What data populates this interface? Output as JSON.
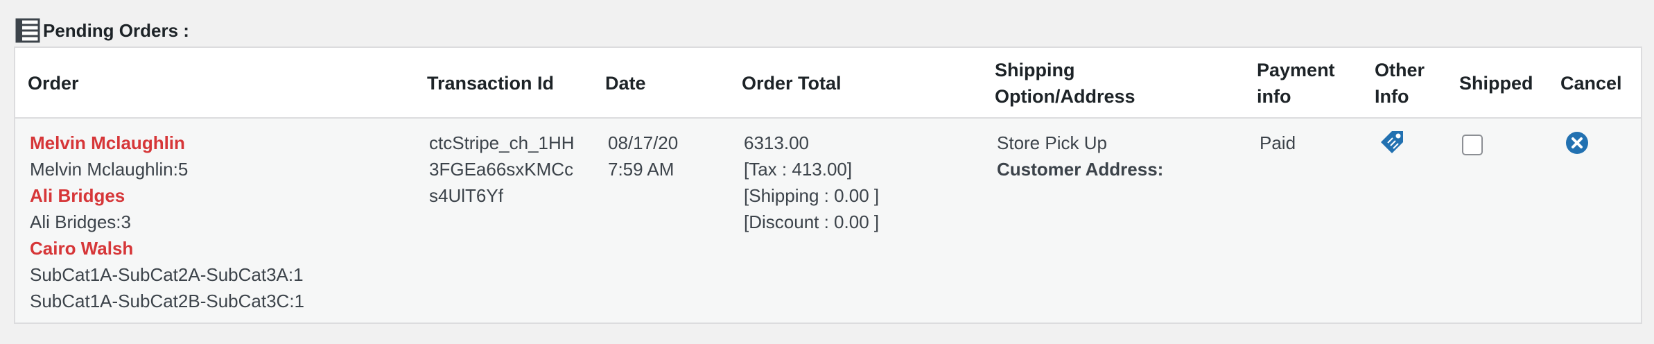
{
  "section": {
    "title": "Pending Orders :",
    "icon": "list-view-icon"
  },
  "table": {
    "columns": {
      "order": "Order",
      "transaction": "Transaction Id",
      "date": "Date",
      "total": "Order Total",
      "shipping_line1": "Shipping",
      "shipping_line2": "Option/Address",
      "payment_line1": "Payment",
      "payment_line2": "info",
      "other_line1": "Other",
      "other_line2": "Info",
      "shipped": "Shipped",
      "cancel": "Cancel"
    },
    "row": {
      "order_lines": [
        {
          "text": "Melvin Mclaughlin",
          "type": "customer"
        },
        {
          "text": "Melvin Mclaughlin:5",
          "type": "item"
        },
        {
          "text": "Ali Bridges",
          "type": "customer"
        },
        {
          "text": "Ali Bridges:3",
          "type": "item"
        },
        {
          "text": "Cairo Walsh",
          "type": "customer"
        },
        {
          "text": "SubCat1A-SubCat2A-SubCat3A:1",
          "type": "item"
        },
        {
          "text": "SubCat1A-SubCat2B-SubCat3C:1",
          "type": "item"
        }
      ],
      "transaction_lines": [
        "ctcStripe_ch_1HH",
        "3FGEa66sxKMCc",
        "s4UlT6Yf"
      ],
      "date": "08/17/20",
      "time": "7:59 AM",
      "total": "6313.00",
      "tax": "[Tax : 413.00]",
      "shipping_cost": "[Shipping : 0.00 ]",
      "discount": "[Discount : 0.00 ]",
      "shipping_option": "Store Pick Up",
      "customer_address_label": "Customer Address:",
      "payment": "Paid",
      "other_info_icon": "tag-icon",
      "shipped_checked": false,
      "cancel_icon": "cancel-circle-icon"
    }
  },
  "colors": {
    "customer_name": "#d63638",
    "icon_blue": "#2271b1",
    "header_bg": "#ffffff",
    "row_bg": "#f6f7f7",
    "border": "#dcdcde"
  }
}
